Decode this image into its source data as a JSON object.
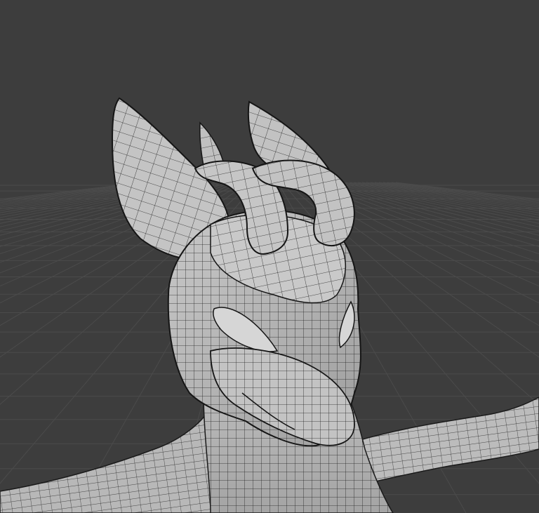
{
  "viewport": {
    "kind": "3d-viewport",
    "display": "wireframe-overlay",
    "background_color": "#3d3d3d",
    "grid_color": "#4a4a4a",
    "mesh_base_color": "#bdbdbd",
    "mesh_shadow_color": "#8f8f8f",
    "wire_color": "#2a2a2a",
    "visible_text": []
  },
  "model": {
    "subject": "creature-head-bust",
    "parts": [
      "left-ear",
      "right-ear",
      "small-horn",
      "left-horn-loop",
      "right-horn-loop",
      "head",
      "snout",
      "eye-left",
      "eye-right",
      "neck",
      "right-arm"
    ]
  }
}
